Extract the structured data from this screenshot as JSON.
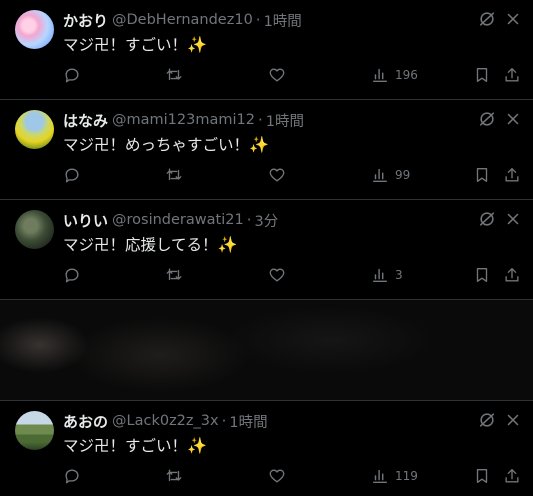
{
  "tweets": [
    {
      "name": "かおり",
      "handle": "@DebHernandez10",
      "sep": "·",
      "time": "1時間",
      "text": "マジ卍！すごい！",
      "emoji": "✨",
      "views": "196"
    },
    {
      "name": "はなみ",
      "handle": "@mami123mami12",
      "sep": "·",
      "time": "1時間",
      "text": "マジ卍！めっちゃすごい！",
      "emoji": "✨",
      "views": "99"
    },
    {
      "name": "いりい",
      "handle": "@rosinderawati21",
      "sep": "·",
      "time": "3分",
      "text": "マジ卍！応援してる！",
      "emoji": "✨",
      "views": "3"
    },
    {
      "name": "あおの",
      "handle": "@Lack0z2z_3x",
      "sep": "·",
      "time": "1時間",
      "text": "マジ卍！すごい！",
      "emoji": "✨",
      "views": "119"
    }
  ],
  "colors": {
    "background": "#000000",
    "text": "#e7e9ea",
    "secondary_text": "#71767b",
    "divider": "#2f3336"
  },
  "icons": [
    "reply-icon",
    "repost-icon",
    "like-icon",
    "views-icon",
    "bookmark-icon",
    "share-icon",
    "grok-icon",
    "more-icon"
  ]
}
